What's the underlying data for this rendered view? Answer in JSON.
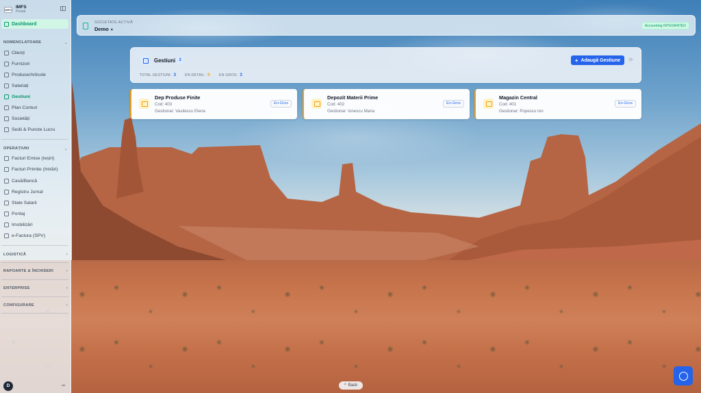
{
  "brand": {
    "name": "IMFS",
    "sub": "Portal",
    "logo": "IMFS"
  },
  "sidebar": {
    "dashboard": "Dashboard",
    "sections": {
      "nomenclatoare": "NOMENCLATOARE",
      "operatiuni": "OPERAȚIUNI",
      "logistica": "LOGISTICĂ",
      "rapoarte": "RAPOARTE & ÎNCHIDERI",
      "enterprise": "ENTERPRISE",
      "configurare": "CONFIGURARE"
    },
    "nomenclatoare_items": [
      {
        "label": "Clienți"
      },
      {
        "label": "Furnizori"
      },
      {
        "label": "Produse/Articole"
      },
      {
        "label": "Salariați"
      },
      {
        "label": "Gestiuni"
      },
      {
        "label": "Plan Conturi"
      },
      {
        "label": "Societăți"
      },
      {
        "label": "Sedii & Puncte Lucru"
      }
    ],
    "operatiuni_items": [
      {
        "label": "Facturi Emise (Ieșiri)"
      },
      {
        "label": "Facturi Primite (Intrări)"
      },
      {
        "label": "Casă/Bancă"
      },
      {
        "label": "Registru Jurnal"
      },
      {
        "label": "State Salarii"
      },
      {
        "label": "Pontaj"
      },
      {
        "label": "Imobilizări"
      },
      {
        "label": "e-Factura (SPV)"
      }
    ],
    "avatar_initial": "D",
    "active_item": "Gestiuni"
  },
  "topbar": {
    "company_label": "SOCIETATE ACTIVĂ",
    "company_value": "Demo",
    "status_badge": "Accounting INTEGRATED"
  },
  "gestiuni": {
    "title": "Gestiuni",
    "count": "3",
    "stats": {
      "total_label": "TOTAL GESTIUNI:",
      "total_value": "3",
      "engros_label": "EN-DETAIL:",
      "engros_value": "0",
      "endetail_label": "EN-GROS:",
      "endetail_value": "3"
    },
    "add_button": "Adaugă Gestiune",
    "cards": [
      {
        "title": "Dep Produse Finite",
        "code": "Cod: 403",
        "manager": "Gestionar: Vasilescu Elena",
        "badge": "En-Gros"
      },
      {
        "title": "Depozit Materii Prime",
        "code": "Cod: 402",
        "manager": "Gestionar: Ionescu Maria",
        "badge": "En-Gros"
      },
      {
        "title": "Magazin Central",
        "code": "Cod: 401",
        "manager": "Gestionar: Popescu Ion",
        "badge": "En-Gros"
      }
    ]
  },
  "back_button": "Back",
  "colors": {
    "accent": "#2563eb",
    "active_green": "#059669",
    "warning_orange": "#f59e0b"
  },
  "icons": {
    "dashboard": "grid-icon",
    "collapse": "sidebar-toggle-icon",
    "chat": "chat-bubble-icon",
    "refresh": "refresh-icon",
    "logout": "logout-icon",
    "company": "building-icon",
    "warehouse": "warehouse-icon"
  }
}
